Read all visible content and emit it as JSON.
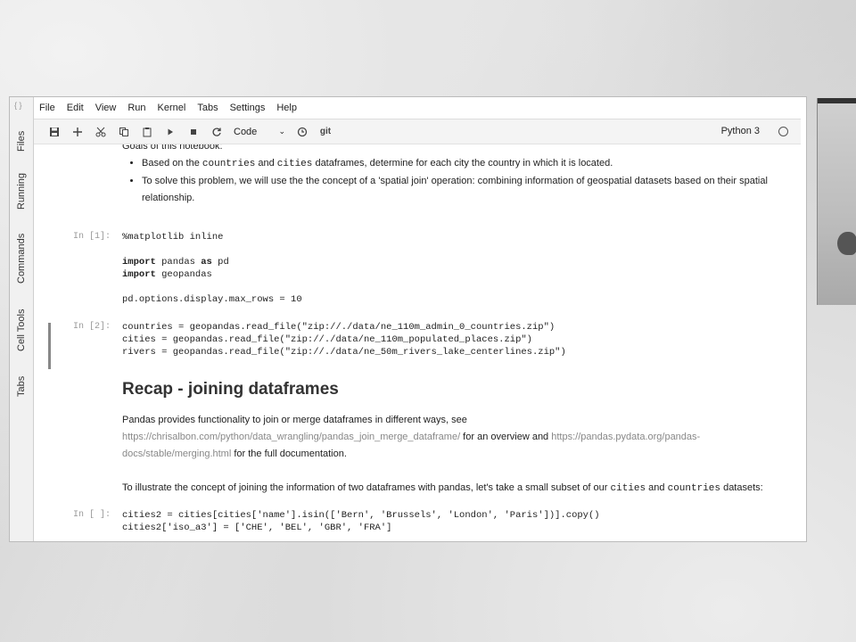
{
  "menu": [
    "File",
    "Edit",
    "View",
    "Run",
    "Kernel",
    "Tabs",
    "Settings",
    "Help"
  ],
  "sidebar": {
    "tabs": [
      "Files",
      "Running",
      "Commands",
      "Cell Tools",
      "Tabs"
    ]
  },
  "toolbar": {
    "icons": [
      "save-icon",
      "add-icon",
      "cut-icon",
      "copy-icon",
      "paste-icon",
      "run-icon",
      "stop-icon",
      "restart-icon",
      "clock-icon",
      "git-icon"
    ],
    "cell_type": "Code",
    "git_label": "git",
    "kernel_name": "Python 3"
  },
  "cells": {
    "goals_heading": "Goals of this notebook:",
    "bullet1_a": "Based on the ",
    "bullet1_code1": "countries",
    "bullet1_b": " and ",
    "bullet1_code2": "cities",
    "bullet1_c": " dataframes, determine for each city the country in which it is located.",
    "bullet2_line1": "To solve this problem, we will use the the concept of a 'spatial join' operation: combining information of geospatial datasets based on their spatial",
    "bullet2_line2": "relationship.",
    "prompt1": "In [1]:",
    "code1_l1": "%matplotlib inline",
    "code1_l3_kw": "import",
    "code1_l3_rest": " pandas ",
    "code1_l3_kw2": "as",
    "code1_l3_end": " pd",
    "code1_l4_kw": "import",
    "code1_l4_rest": " geopandas",
    "code1_l6": "pd.options.display.max_rows = 10",
    "prompt2": "In [2]:",
    "code2_l1": "countries = geopandas.read_file(\"zip://./data/ne_110m_admin_0_countries.zip\")",
    "code2_l2": "cities = geopandas.read_file(\"zip://./data/ne_110m_populated_places.zip\")",
    "code2_l3": "rivers = geopandas.read_file(\"zip://./data/ne_50m_rivers_lake_centerlines.zip\")",
    "recap_heading": "Recap - joining dataframes",
    "recap_p1": "Pandas provides functionality to join or merge dataframes in different ways, see",
    "recap_link1": "https://chrisalbon.com/python/data_wrangling/pandas_join_merge_dataframe/",
    "recap_mid": " for an overview and ",
    "recap_link2a": "https://pandas.pydata.org/pandas-",
    "recap_link2b": "docs/stable/merging.html",
    "recap_end": " for the full documentation.",
    "illus_a": "To illustrate the concept of joining the information of two dataframes with pandas, let's take a small subset of our ",
    "illus_code1": "cities",
    "illus_b": " and ",
    "illus_code2": "countries",
    "illus_c": " datasets:",
    "prompt3": "In [ ]:",
    "code3_l1": "cities2 = cities[cities['name'].isin(['Bern', 'Brussels', 'London', 'Paris'])].copy()",
    "code3_l2": "cities2['iso_a3'] = ['CHE', 'BEL', 'GBR', 'FRA']"
  }
}
